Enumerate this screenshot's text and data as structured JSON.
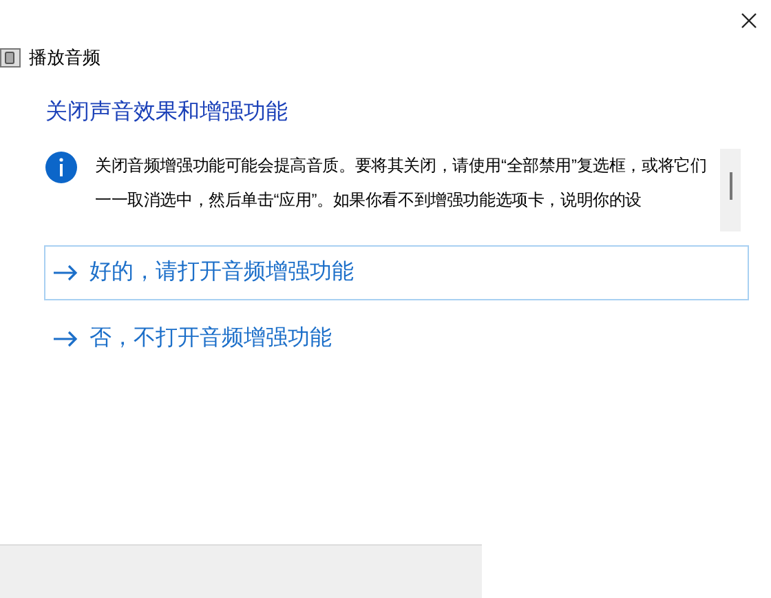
{
  "window": {
    "title": "播放音频"
  },
  "heading": "关闭声音效果和增强功能",
  "info": "关闭音频增强功能可能会提高音质。要将其关闭，请使用“全部禁用”复选框，或将它们一一取消选中，然后单击“应用”。如果你看不到增强功能选项卡，说明你的设",
  "options": [
    {
      "label": "好的，请打开音频增强功能",
      "selected": true
    },
    {
      "label": "否，不打开音频增强功能",
      "selected": false
    }
  ]
}
